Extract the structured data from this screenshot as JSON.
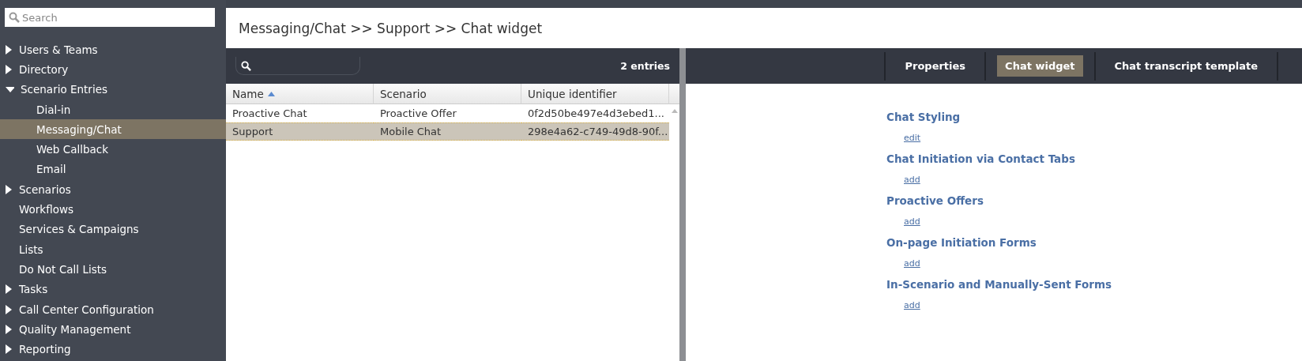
{
  "sidebar": {
    "search": {
      "placeholder": "Search"
    },
    "items": [
      {
        "label": "Users & Teams",
        "kind": "folder",
        "expanded": false,
        "selected": false
      },
      {
        "label": "Directory",
        "kind": "folder",
        "expanded": false,
        "selected": false
      },
      {
        "label": "Scenario Entries",
        "kind": "folder",
        "expanded": true,
        "selected": false,
        "children": [
          {
            "label": "Dial-in",
            "kind": "page",
            "selected": false
          },
          {
            "label": "Messaging/Chat",
            "kind": "page",
            "selected": true
          },
          {
            "label": "Web Callback",
            "kind": "page",
            "selected": false
          },
          {
            "label": "Email",
            "kind": "page",
            "selected": false
          }
        ]
      },
      {
        "label": "Scenarios",
        "kind": "folder",
        "expanded": false,
        "selected": false
      },
      {
        "label": "Workflows",
        "kind": "page",
        "selected": false
      },
      {
        "label": "Services & Campaigns",
        "kind": "page",
        "selected": false
      },
      {
        "label": "Lists",
        "kind": "page",
        "selected": false
      },
      {
        "label": "Do Not Call Lists",
        "kind": "page",
        "selected": false
      },
      {
        "label": "Tasks",
        "kind": "folder",
        "expanded": false,
        "selected": false
      },
      {
        "label": "Call Center Configuration",
        "kind": "folder",
        "expanded": false,
        "selected": false
      },
      {
        "label": "Quality Management",
        "kind": "folder",
        "expanded": false,
        "selected": false
      },
      {
        "label": "Reporting",
        "kind": "folder",
        "expanded": false,
        "selected": false
      }
    ]
  },
  "breadcrumb": "Messaging/Chat >> Support >> Chat widget",
  "list": {
    "count": "2 entries",
    "columns": [
      {
        "label": "Name",
        "sorted": true
      },
      {
        "label": "Scenario",
        "sorted": false
      },
      {
        "label": "Unique identifier",
        "sorted": false
      }
    ],
    "rows": [
      {
        "cells": [
          "Proactive Chat",
          "Proactive Offer",
          "0f2d50be497e4d3ebed1..."
        ],
        "selected": false
      },
      {
        "cells": [
          "Support",
          "Mobile Chat",
          "298e4a62-c749-49d8-90f..."
        ],
        "selected": true
      }
    ]
  },
  "tabs": [
    {
      "label": "Properties",
      "selected": false
    },
    {
      "label": "Chat widget",
      "selected": true
    },
    {
      "label": "Chat transcript template",
      "selected": false
    }
  ],
  "sections": [
    {
      "title": "Chat Styling",
      "link": "edit"
    },
    {
      "title": "Chat Initiation via Contact Tabs",
      "link": "add"
    },
    {
      "title": "Proactive Offers",
      "link": "add"
    },
    {
      "title": "On-page Initiation Forms",
      "link": "add"
    },
    {
      "title": "In-Scenario and Manually-Sent Forms",
      "link": "add"
    }
  ]
}
